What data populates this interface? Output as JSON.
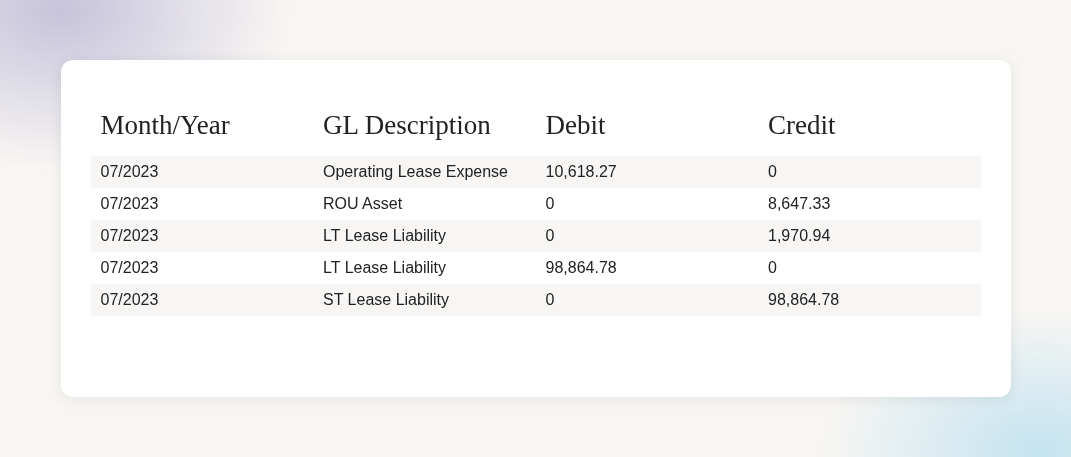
{
  "table": {
    "columns": [
      "Month/Year",
      "GL Description",
      "Debit",
      "Credit"
    ],
    "rows": [
      [
        "07/2023",
        "Operating Lease Expense",
        "10,618.27",
        "0"
      ],
      [
        "07/2023",
        "ROU Asset",
        "0",
        "8,647.33"
      ],
      [
        "07/2023",
        "LT Lease Liability",
        "0",
        "1,970.94"
      ],
      [
        "07/2023",
        "LT Lease Liability",
        "98,864.78",
        "0"
      ],
      [
        "07/2023",
        "ST Lease Liability",
        "0",
        "98,864.78"
      ]
    ]
  }
}
